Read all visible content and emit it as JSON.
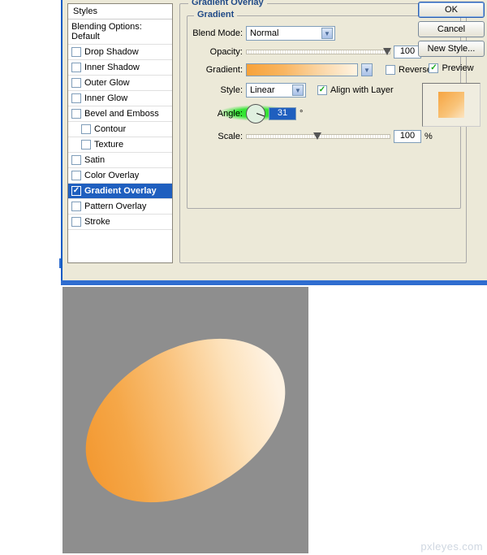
{
  "styles_header": "Styles",
  "blending_default": "Blending Options: Default",
  "style_items": {
    "drop_shadow": "Drop Shadow",
    "inner_shadow": "Inner Shadow",
    "outer_glow": "Outer Glow",
    "inner_glow": "Inner Glow",
    "bevel_emboss": "Bevel and Emboss",
    "contour": "Contour",
    "texture": "Texture",
    "satin": "Satin",
    "color_overlay": "Color Overlay",
    "gradient_overlay": "Gradient Overlay",
    "pattern_overlay": "Pattern Overlay",
    "stroke": "Stroke"
  },
  "group": {
    "title": "Gradient Overlay",
    "inner_title": "Gradient",
    "blend_mode_label": "Blend Mode:",
    "blend_mode_value": "Normal",
    "opacity_label": "Opacity:",
    "opacity_value": "100",
    "opacity_unit": "%",
    "gradient_label": "Gradient:",
    "reverse_label": "Reverse",
    "style_label": "Style:",
    "style_value": "Linear",
    "align_label": "Align with Layer",
    "angle_label": "Angle:",
    "angle_value": "31",
    "angle_unit": "°",
    "scale_label": "Scale:",
    "scale_value": "100",
    "scale_unit": "%"
  },
  "buttons": {
    "ok": "OK",
    "cancel": "Cancel",
    "new_style": "New Style...",
    "preview": "Preview"
  },
  "watermark": "pxleyes.com"
}
